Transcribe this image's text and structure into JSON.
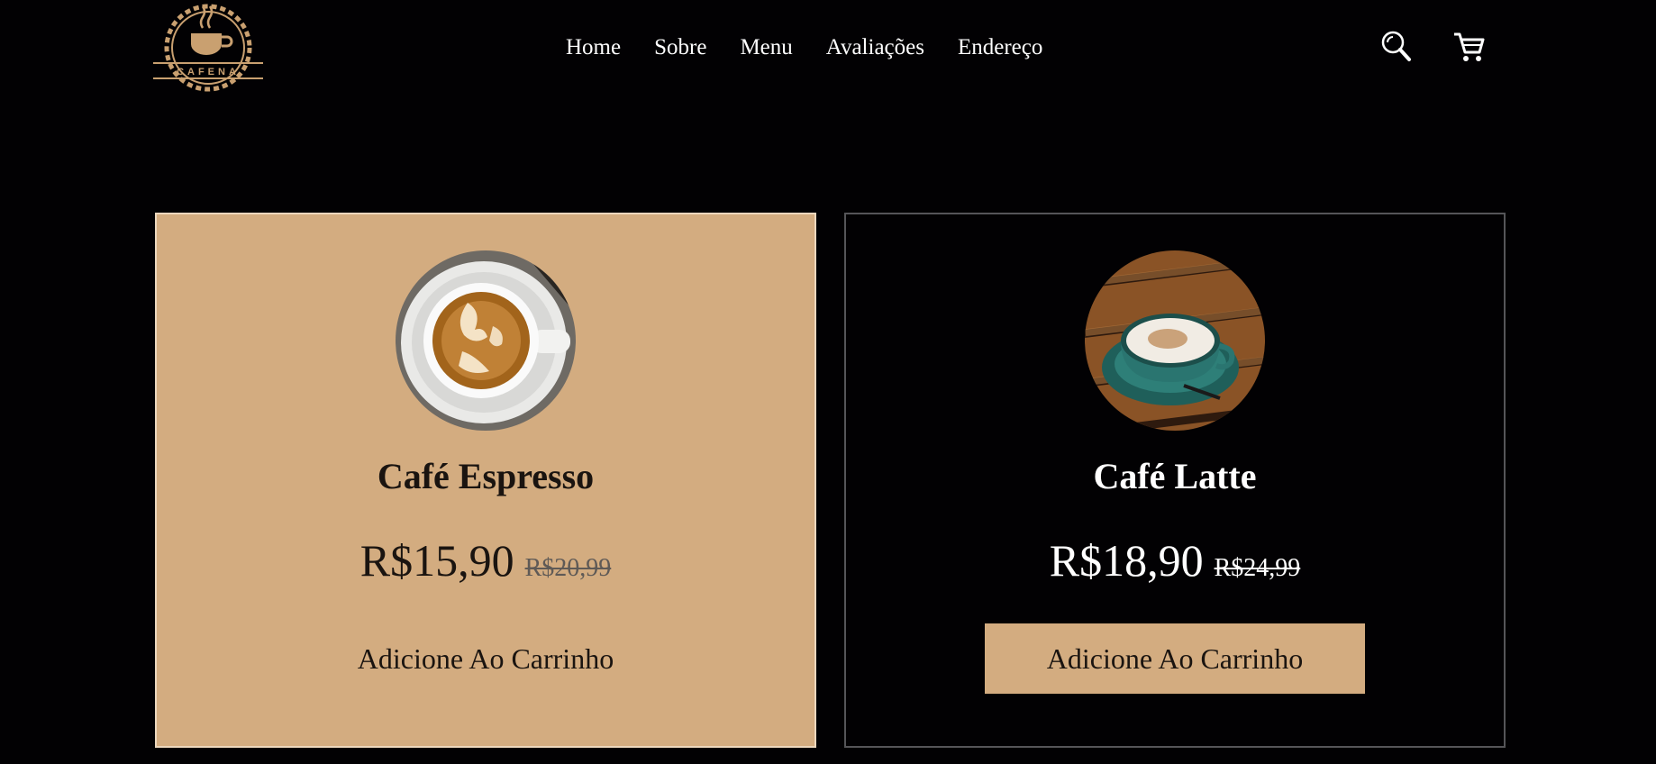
{
  "brand": {
    "logo_text": "CAFENA",
    "accent_color": "#d3ac80"
  },
  "nav": {
    "items": [
      {
        "label": "Home"
      },
      {
        "label": "Sobre"
      },
      {
        "label": "Menu"
      },
      {
        "label": "Avaliações"
      },
      {
        "label": "Endereço"
      }
    ]
  },
  "header_icons": {
    "search": "search-icon",
    "cart": "cart-icon"
  },
  "products": [
    {
      "name": "Café Espresso",
      "price": "R$15,90",
      "old_price": "R$20,99",
      "button_label": "Adicione Ao Carrinho",
      "image": "latte-art-cup-photo"
    },
    {
      "name": "Café Latte",
      "price": "R$18,90",
      "old_price": "R$24,99",
      "button_label": "Adicione Ao Carrinho",
      "image": "teal-cup-on-wooden-table-photo"
    }
  ]
}
